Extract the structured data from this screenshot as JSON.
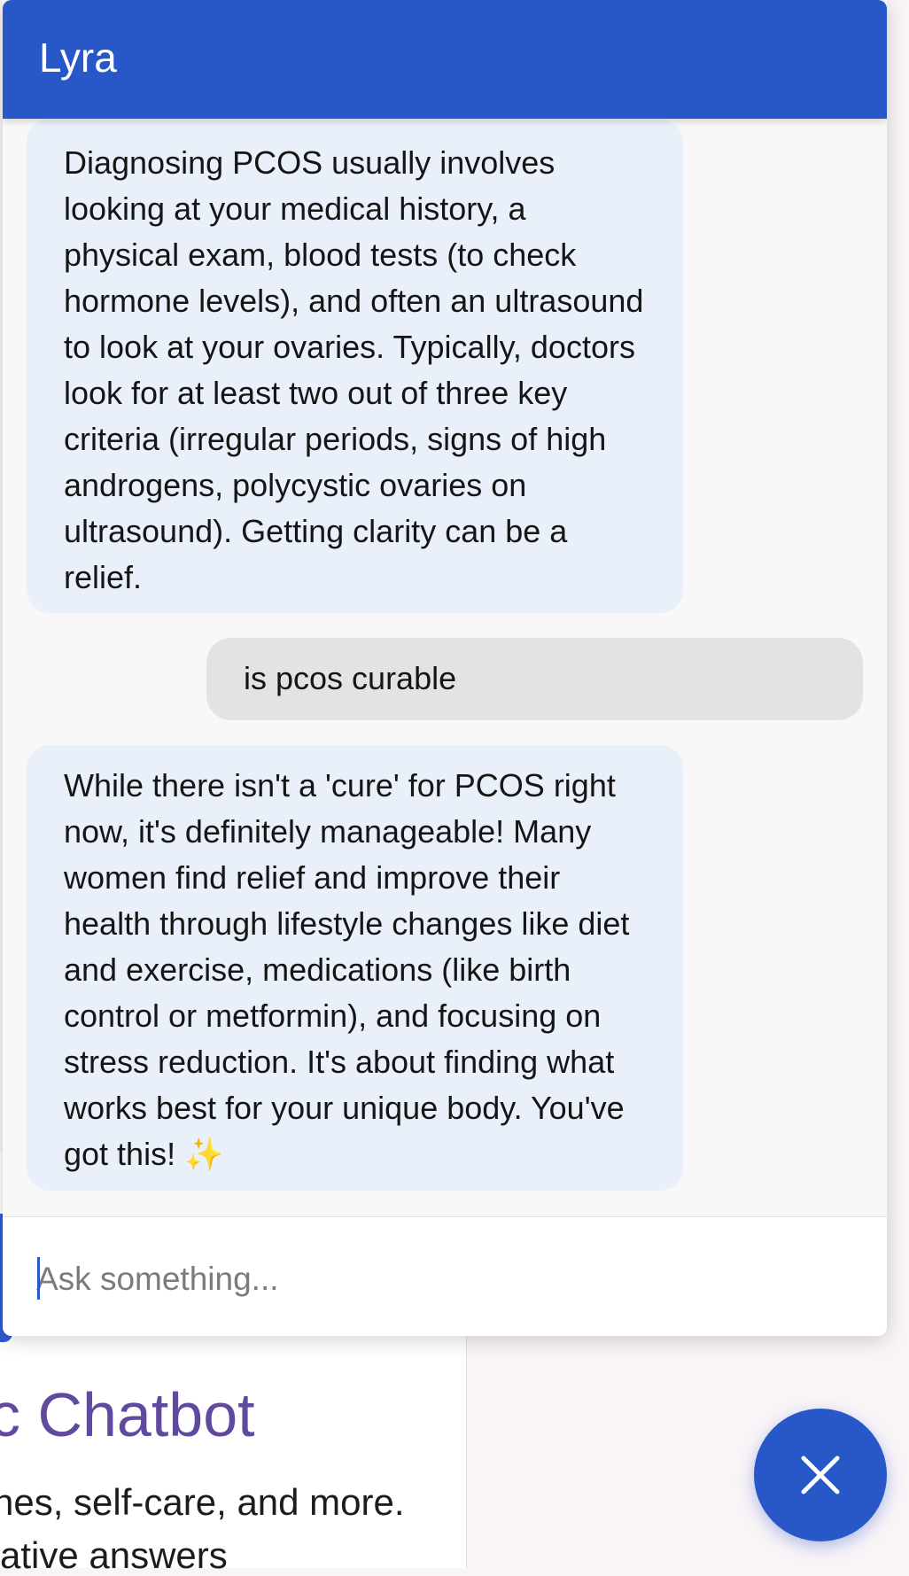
{
  "background_page": {
    "heading": "c Chatbot",
    "subline_1": "nes, self-care, and more.",
    "subline_2": "ative answers"
  },
  "chat": {
    "title": "Lyra",
    "messages": [
      {
        "role": "bot",
        "text": "Diagnosing PCOS usually involves looking at your medical history, a physical exam, blood tests (to check hormone levels), and often an ultrasound to look at your ovaries. Typically, doctors look for at least two out of three key criteria (irregular periods, signs of high androgens, polycystic ovaries on ultrasound). Getting clarity can be a relief."
      },
      {
        "role": "user",
        "text": "is pcos curable"
      },
      {
        "role": "bot",
        "text": "While there isn't a 'cure' for PCOS right now, it's definitely manageable! Many women find relief and improve their health through lifestyle changes like diet and exercise, medications (like birth control or metformin), and focusing on stress reduction. It's about finding what works best for your unique body. You've got this! ✨"
      }
    ],
    "input": {
      "placeholder": "Ask something...",
      "value": ""
    },
    "close_icon": "close-icon"
  },
  "colors": {
    "primary": "#2857c8",
    "bot_bubble": "#eaf0fa",
    "user_bubble": "#e2e3e3",
    "heading_purple": "#5f4aa0"
  }
}
